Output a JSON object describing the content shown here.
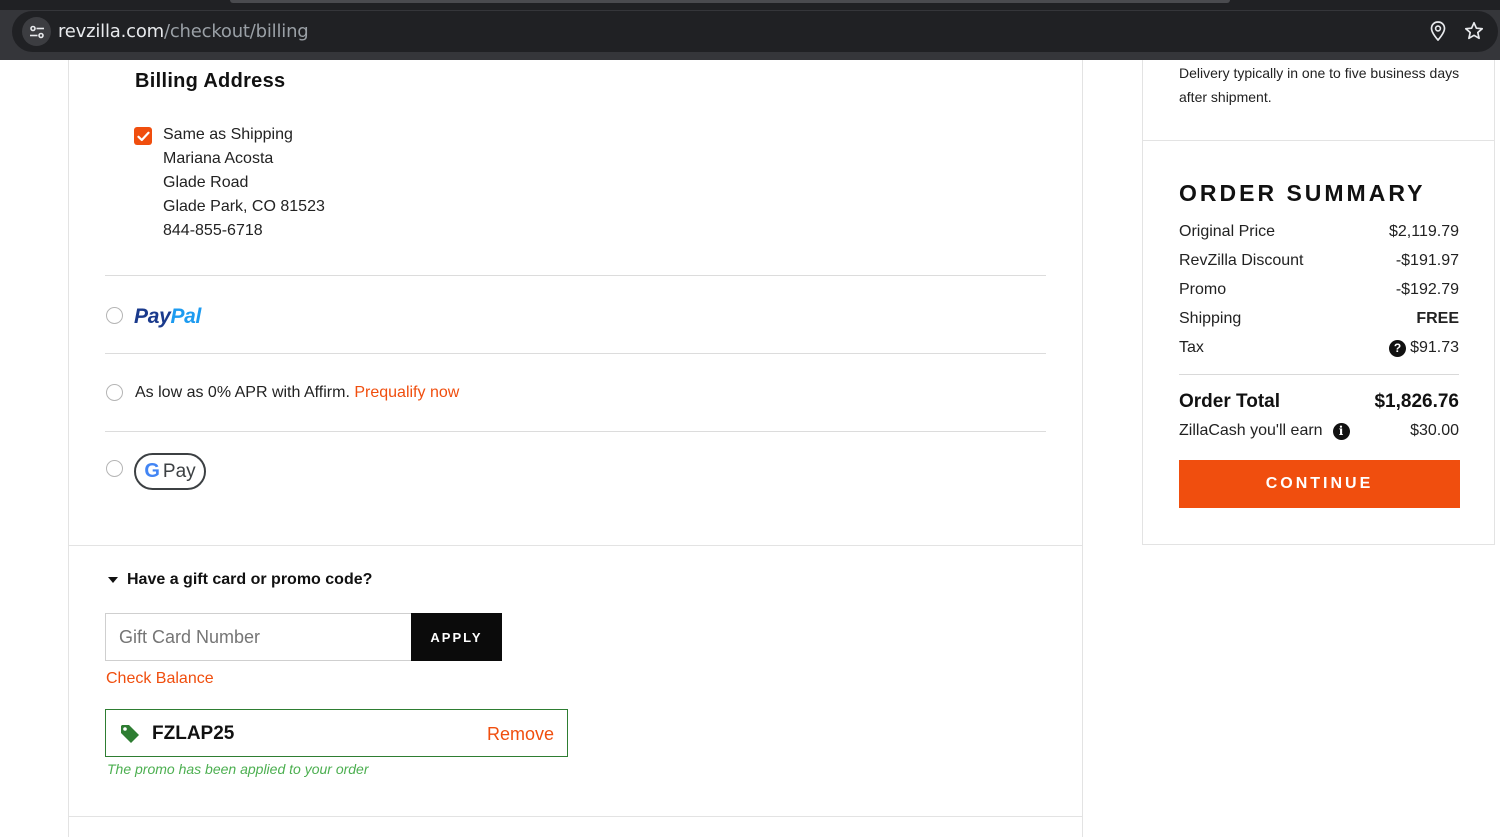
{
  "browser": {
    "url_host": "revzilla.com",
    "url_path": "/checkout/billing"
  },
  "billing": {
    "title": "Billing Address",
    "same_as_shipping_label": "Same as Shipping",
    "same_as_shipping_checked": true,
    "address_lines": [
      "Mariana Acosta",
      "Glade Road",
      "Glade Park, CO 81523",
      "844-855-6718"
    ]
  },
  "payment": {
    "paypal_pay": "Pay",
    "paypal_pal": "Pal",
    "affirm_text": "As low as 0% APR with Affirm.",
    "affirm_link": "Prequalify now",
    "gpay_g": "G",
    "gpay_label": "Pay"
  },
  "promo": {
    "toggle_label": "Have a gift card or promo code?",
    "gift_card_placeholder": "Gift Card Number",
    "apply_label": "APPLY",
    "check_balance_label": "Check Balance",
    "applied_code": "FZLAP25",
    "remove_label": "Remove",
    "applied_message": "The promo has been applied to your order"
  },
  "shipping_note": "Delivery typically in one to five business days after shipment.",
  "summary": {
    "title": "ORDER SUMMARY",
    "rows": [
      {
        "label": "Original Price",
        "value": "$2,119.79"
      },
      {
        "label": "RevZilla Discount",
        "value": "-$191.97"
      },
      {
        "label": "Promo",
        "value": "-$192.79"
      },
      {
        "label": "Shipping",
        "value": "FREE"
      },
      {
        "label": "Tax",
        "value": "$91.73"
      }
    ],
    "tax_help_icon": "?",
    "total_label": "Order Total",
    "total_value": "$1,826.76",
    "zillacash_label": "ZillaCash you'll earn",
    "zillacash_info_icon": "i",
    "zillacash_value": "$30.00",
    "continue_label": "CONTINUE"
  },
  "colors": {
    "accent": "#f04e0e",
    "promo_border": "#2e7d32",
    "promo_message": "#4caf50",
    "paypal_dark": "#1a3a8c",
    "paypal_light": "#1d9bf0"
  }
}
